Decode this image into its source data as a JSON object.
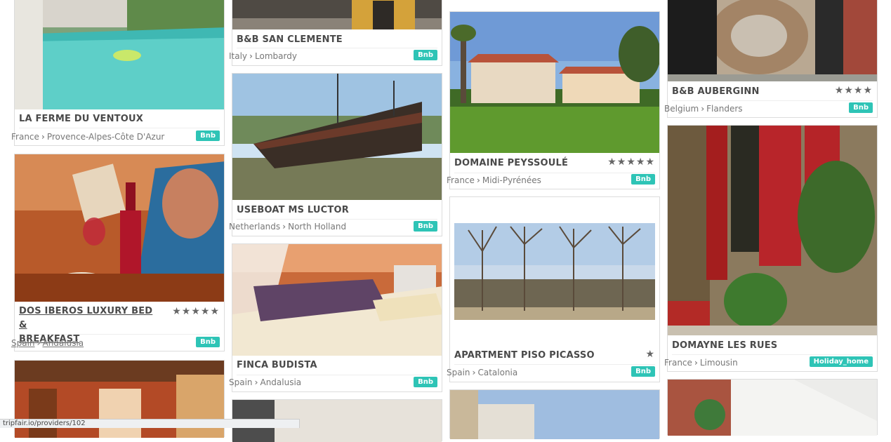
{
  "cards": {
    "ventoux": {
      "title": "LA FERME DU VENTOUX",
      "country": "France",
      "region": "Provence-Alpes-Côte D'Azur",
      "badge": "Bnb"
    },
    "iberos": {
      "title_line1": "DOS IBEROS LUXURY BED &",
      "title_line2": "BREAKFAST",
      "stars": "★★★★★",
      "country": "Spain",
      "region": "Andalusia",
      "badge": "Bnb"
    },
    "clemente": {
      "title": "B&B SAN CLEMENTE",
      "country": "Italy",
      "region": "Lombardy",
      "badge": "Bnb"
    },
    "luctor": {
      "title": "USEBOAT MS LUCTOR",
      "country": "Netherlands",
      "region": "North Holland",
      "badge": "Bnb"
    },
    "budista": {
      "title": "FINCA BUDISTA",
      "country": "Spain",
      "region": "Andalusia",
      "badge": "Bnb"
    },
    "peyssoule": {
      "title": "DOMAINE PEYSSOULÉ",
      "stars": "★★★★★",
      "country": "France",
      "region": "Midi-Pyrénées",
      "badge": "Bnb"
    },
    "picasso": {
      "title": "APARTMENT PISO PICASSO",
      "stars": "★",
      "country": "Spain",
      "region": "Catalonia",
      "badge": "Bnb"
    },
    "auberginn": {
      "title": "B&B AUBERGINN",
      "stars": "★★★★",
      "country": "Belgium",
      "region": "Flanders",
      "badge": "Bnb"
    },
    "rues": {
      "title": "DOMAYNE LES RUES",
      "country": "France",
      "region": "Limousin",
      "badge": "Holiday_home"
    }
  },
  "status_url": "tripfair.io/providers/102",
  "icons": {
    "chevron": "chevron-right-icon",
    "star": "star-icon"
  },
  "colors": {
    "badge": "#2ec4b6",
    "title": "#4a4a4a"
  }
}
